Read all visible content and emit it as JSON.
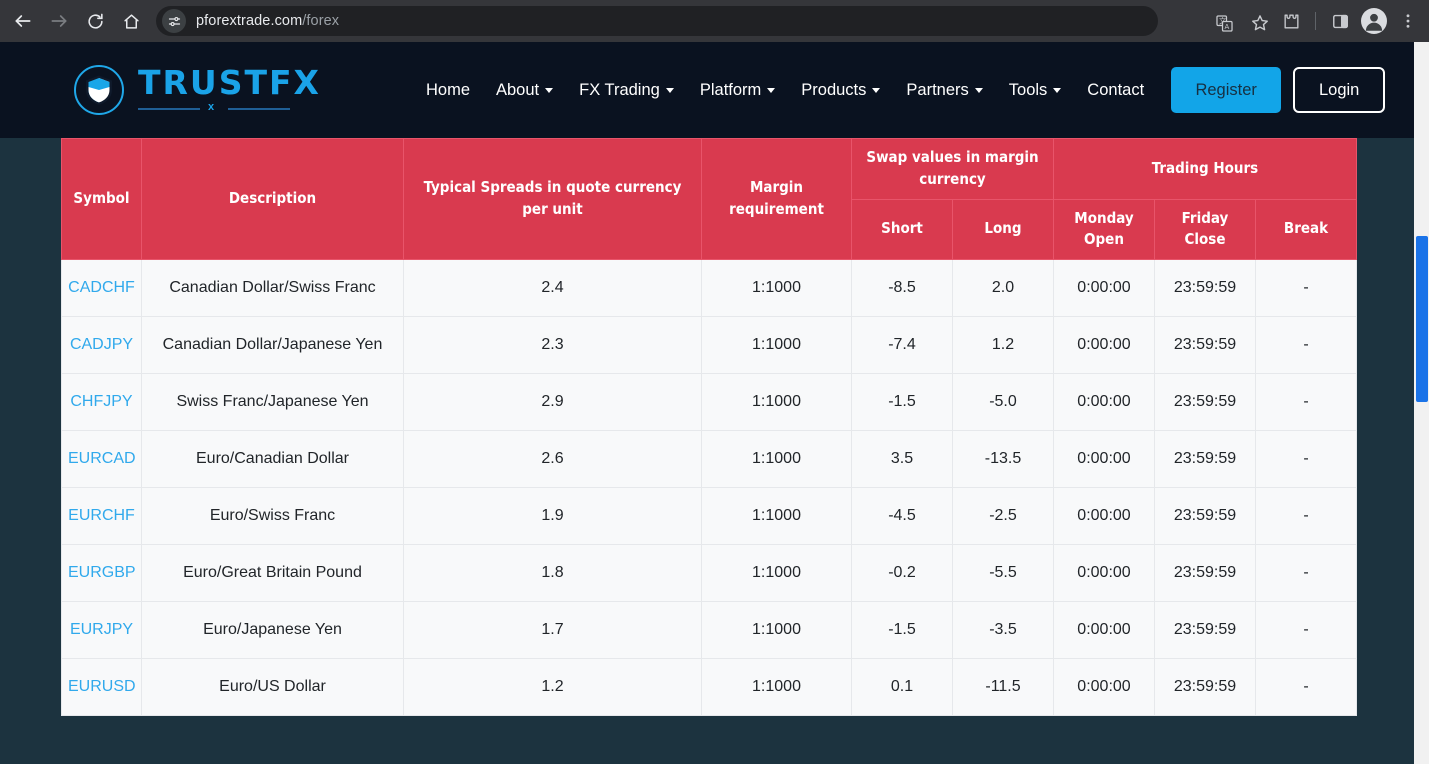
{
  "browser": {
    "back_icon": "back-arrow-icon",
    "forward_icon": "forward-arrow-icon",
    "reload_icon": "reload-icon",
    "home_icon": "home-icon",
    "site_info_icon": "site-settings-tune-icon",
    "url_domain": "pforextrade.com",
    "url_path": "/forex",
    "translate_icon": "translate-icon",
    "bookmark_icon": "bookmark-star-icon",
    "extensions_icon": "extensions-puzzle-icon",
    "side_panel_icon": "side-panel-icon",
    "profile_icon": "profile-avatar-icon",
    "menu_icon": "three-dot-menu-icon"
  },
  "site": {
    "logo_text": "TRUSTFX",
    "logo_sub_mark": "x",
    "nav": [
      {
        "label": "Home",
        "has_dropdown": false
      },
      {
        "label": "About",
        "has_dropdown": true
      },
      {
        "label": "FX Trading",
        "has_dropdown": true
      },
      {
        "label": "Platform",
        "has_dropdown": true
      },
      {
        "label": "Products",
        "has_dropdown": true
      },
      {
        "label": "Partners",
        "has_dropdown": true
      },
      {
        "label": "Tools",
        "has_dropdown": true
      },
      {
        "label": "Contact",
        "has_dropdown": false
      }
    ],
    "register_label": "Register",
    "login_label": "Login"
  },
  "colors": {
    "header_bg": "#0a1220",
    "page_bg": "#1c333f",
    "table_header_red": "#d93a4f",
    "link_blue": "#30a9ec",
    "register_blue": "#12a5e8",
    "scrollbar_thumb": "#1a73e8"
  },
  "table": {
    "headers": {
      "symbol": "Symbol",
      "description": "Description",
      "spreads": "Typical Spreads in quote currency per unit",
      "margin": "Margin requirement",
      "swap_group": "Swap values in margin currency",
      "trading_hours_group": "Trading Hours",
      "short": "Short",
      "long": "Long",
      "monday_open": "Monday Open",
      "friday_close": "Friday Close",
      "break": "Break"
    },
    "rows": [
      {
        "symbol": "CADCHF",
        "description": "Canadian Dollar/Swiss Franc",
        "spread": "2.4",
        "margin": "1:1000",
        "short": "-8.5",
        "long": "2.0",
        "monday_open": "0:00:00",
        "friday_close": "23:59:59",
        "break": "-"
      },
      {
        "symbol": "CADJPY",
        "description": "Canadian Dollar/Japanese Yen",
        "spread": "2.3",
        "margin": "1:1000",
        "short": "-7.4",
        "long": "1.2",
        "monday_open": "0:00:00",
        "friday_close": "23:59:59",
        "break": "-"
      },
      {
        "symbol": "CHFJPY",
        "description": "Swiss Franc/Japanese Yen",
        "spread": "2.9",
        "margin": "1:1000",
        "short": "-1.5",
        "long": "-5.0",
        "monday_open": "0:00:00",
        "friday_close": "23:59:59",
        "break": "-"
      },
      {
        "symbol": "EURCAD",
        "description": "Euro/Canadian Dollar",
        "spread": "2.6",
        "margin": "1:1000",
        "short": "3.5",
        "long": "-13.5",
        "monday_open": "0:00:00",
        "friday_close": "23:59:59",
        "break": "-"
      },
      {
        "symbol": "EURCHF",
        "description": "Euro/Swiss Franc",
        "spread": "1.9",
        "margin": "1:1000",
        "short": "-4.5",
        "long": "-2.5",
        "monday_open": "0:00:00",
        "friday_close": "23:59:59",
        "break": "-"
      },
      {
        "symbol": "EURGBP",
        "description": "Euro/Great Britain Pound",
        "spread": "1.8",
        "margin": "1:1000",
        "short": "-0.2",
        "long": "-5.5",
        "monday_open": "0:00:00",
        "friday_close": "23:59:59",
        "break": "-"
      },
      {
        "symbol": "EURJPY",
        "description": "Euro/Japanese Yen",
        "spread": "1.7",
        "margin": "1:1000",
        "short": "-1.5",
        "long": "-3.5",
        "monday_open": "0:00:00",
        "friday_close": "23:59:59",
        "break": "-"
      },
      {
        "symbol": "EURUSD",
        "description": "Euro/US Dollar",
        "spread": "1.2",
        "margin": "1:1000",
        "short": "0.1",
        "long": "-11.5",
        "monday_open": "0:00:00",
        "friday_close": "23:59:59",
        "break": "-"
      }
    ]
  }
}
